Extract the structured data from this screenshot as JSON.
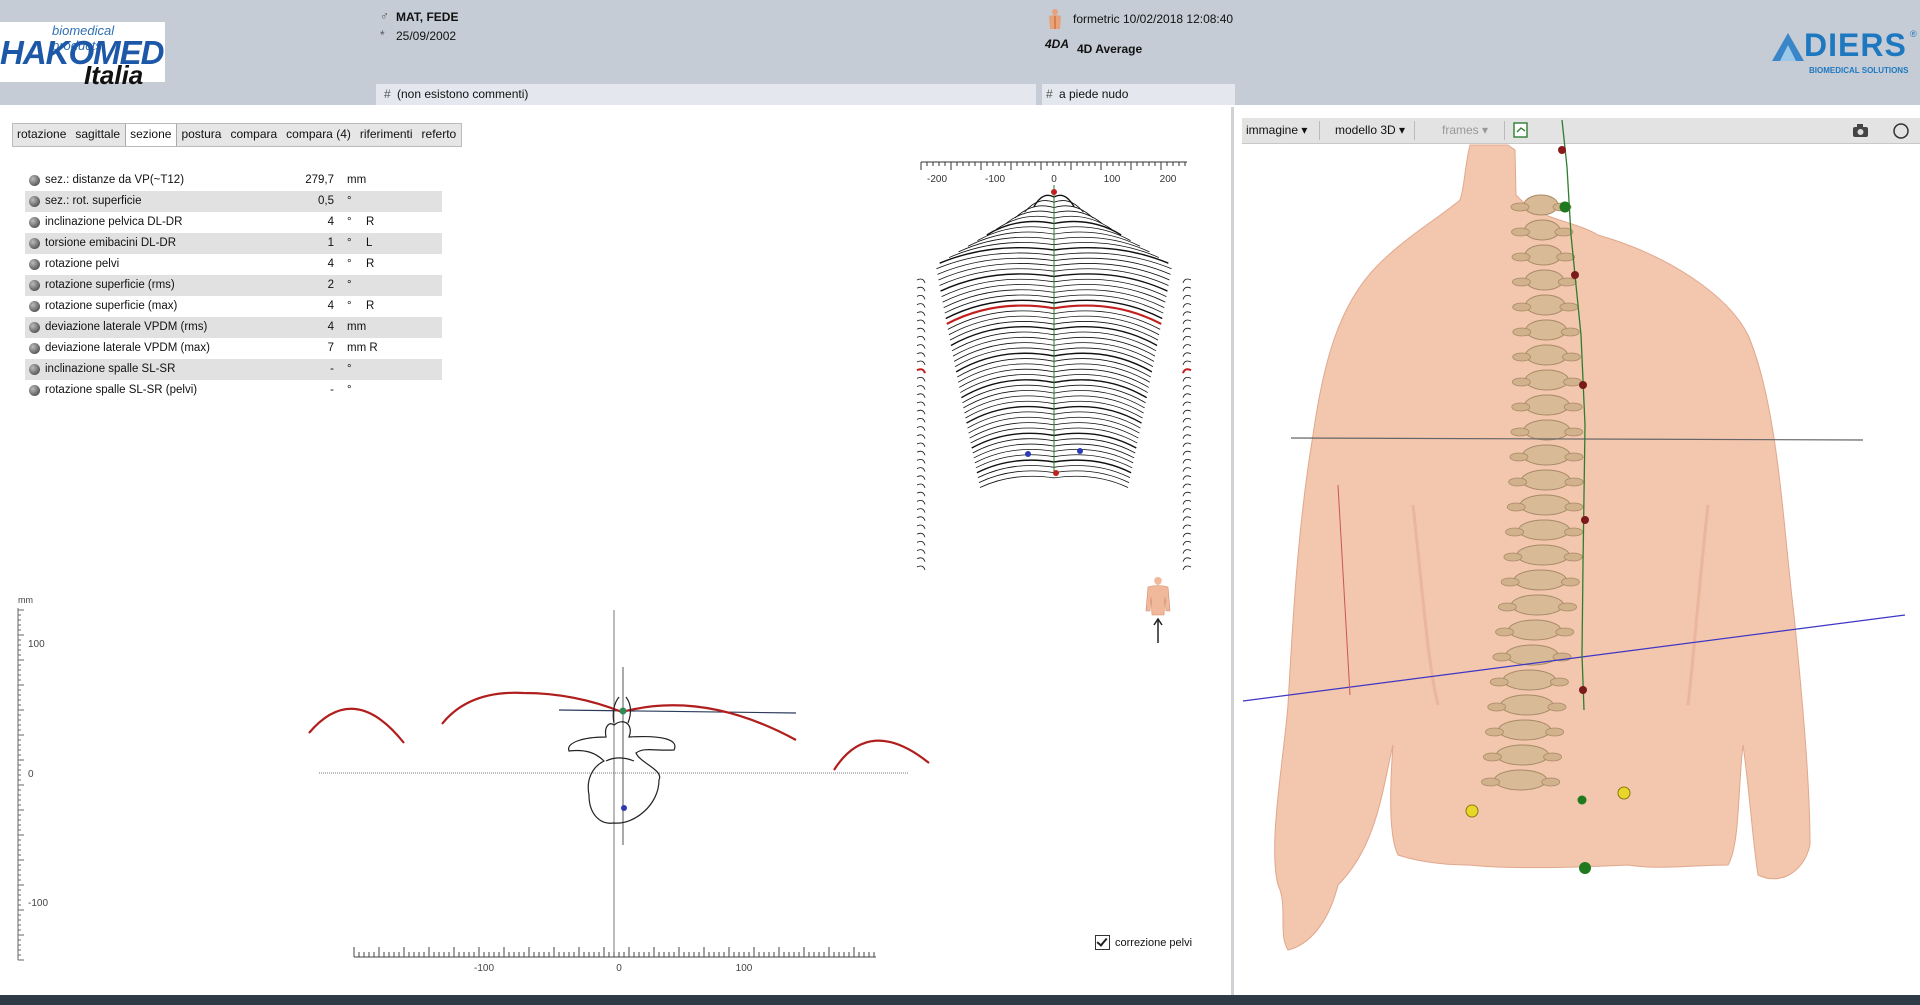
{
  "header": {
    "logo_top": "biomedical products",
    "logo_main": "HAKOMED",
    "logo_sub": "Italia",
    "patient_name": "MAT, FEDE",
    "birth_date": "25/09/2002",
    "comment": "(non esistono commenti)",
    "scan_info": "formetric 10/02/2018 12:08:40",
    "average_icon": "4DA",
    "average_label": "4D Average",
    "footwear_note": "a piede nudo",
    "hash": "#",
    "male_symbol": "♂",
    "birth_symbol": "*",
    "brand_name": "DIERS",
    "brand_reg": "®",
    "brand_sub": "BIOMEDICAL SOLUTIONS"
  },
  "tabs": [
    "rotazione",
    "sagittale",
    "sezione",
    "postura",
    "compara",
    "compara (4)",
    "riferimenti",
    "referto"
  ],
  "active_tab": "sezione",
  "measurements": [
    {
      "label": "sez.: distanze da VP(~T12)",
      "value": "279,7",
      "unit": "mm",
      "side": ""
    },
    {
      "label": "sez.: rot. superficie",
      "value": "0,5",
      "unit": "°",
      "side": ""
    },
    {
      "label": "inclinazione pelvica DL-DR",
      "value": "4",
      "unit": "°",
      "side": "R"
    },
    {
      "label": "torsione emibacini DL-DR",
      "value": "1",
      "unit": "°",
      "side": "L"
    },
    {
      "label": "rotazione pelvi",
      "value": "4",
      "unit": "°",
      "side": "R"
    },
    {
      "label": "rotazione superficie (rms)",
      "value": "2",
      "unit": "°",
      "side": ""
    },
    {
      "label": "rotazione superficie (max)",
      "value": "4",
      "unit": "°",
      "side": "R"
    },
    {
      "label": "deviazione laterale VPDM (rms)",
      "value": "4",
      "unit": "mm",
      "side": ""
    },
    {
      "label": "deviazione laterale VPDM (max)",
      "value": "7",
      "unit": "mm R",
      "side": ""
    },
    {
      "label": "inclinazione spalle SL-SR",
      "value": "-",
      "unit": "°",
      "side": ""
    },
    {
      "label": "rotazione spalle SL-SR (pelvi)",
      "value": "-",
      "unit": "°",
      "side": ""
    }
  ],
  "contour_view": {
    "axis_ticks": [
      "-200",
      "-100",
      "0",
      "100",
      "200"
    ]
  },
  "section_view": {
    "y_unit": "mm",
    "y_ticks": [
      "100",
      "0",
      "-100"
    ],
    "x_ticks": [
      "-100",
      "0",
      "100"
    ]
  },
  "pelvic_correction": {
    "label": "correzione pelvi",
    "checked": true
  },
  "viewer_toolbar": {
    "image": "immagine ▾",
    "model": "modello 3D ▾",
    "frames": "frames ▾"
  },
  "icons": {
    "male": "male-icon",
    "birth": "birth-icon",
    "scan": "body-scan-icon",
    "export": "export-icon",
    "camera": "camera-icon",
    "circle": "circle-icon",
    "person": "person-back-icon"
  },
  "colors": {
    "header_bg": "#c5ccd6",
    "skin": "#f3c6ae",
    "contour_highlight": "#c21f1f",
    "spine_line": "#2e8b2e",
    "pelvis_line": "#4b44c8"
  }
}
